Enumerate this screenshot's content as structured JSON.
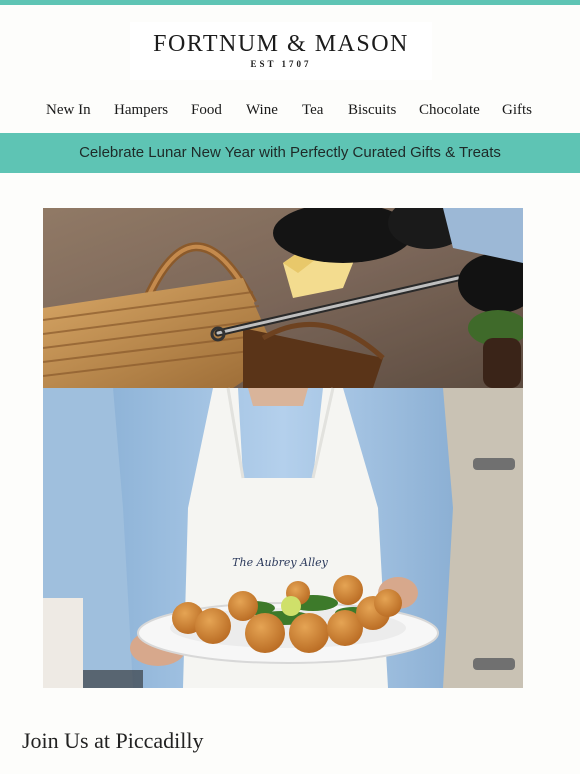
{
  "brand": {
    "name": "FORTNUM & MASON",
    "established": "EST 1707"
  },
  "nav": {
    "items": [
      "New In",
      "Hampers",
      "Food",
      "Wine",
      "Tea",
      "Biscuits",
      "Chocolate",
      "Gifts"
    ]
  },
  "banner": {
    "text": "Celebrate Lunar New Year with Perfectly Curated Gifts & Treats"
  },
  "hero": {
    "apron_logo_text": "The Aubrey Alley"
  },
  "section": {
    "title": "Join Us at Piccadilly"
  },
  "colors": {
    "accent_teal": "#5ec4b4",
    "background": "#fdfdfb",
    "text": "#1a1a1a"
  }
}
